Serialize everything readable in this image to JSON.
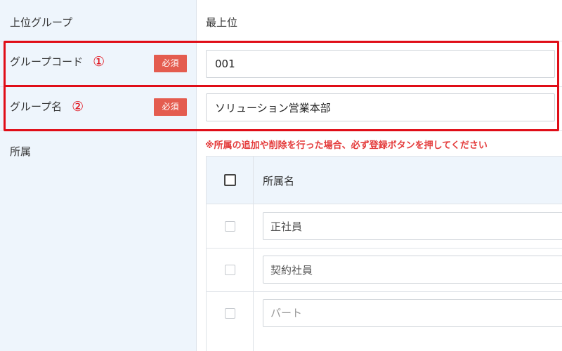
{
  "form": {
    "parent_group": {
      "label": "上位グループ",
      "value": "最上位"
    },
    "group_code": {
      "label": "グループコード",
      "marker": "①",
      "required_badge": "必須",
      "value": "001"
    },
    "group_name": {
      "label": "グループ名",
      "marker": "②",
      "required_badge": "必須",
      "value": "ソリューション営業本部"
    },
    "affiliation": {
      "label": "所属",
      "warning": "※所属の追加や削除を行った場合、必ず登録ボタンを押してください",
      "table": {
        "header": "所属名",
        "rows": [
          {
            "value": "正社員",
            "checked": false
          },
          {
            "value": "契約社員",
            "checked": false
          },
          {
            "value": "",
            "placeholder": "パート",
            "checked": false
          }
        ]
      }
    }
  },
  "colors": {
    "label_background": "#eef5fc",
    "highlight_border": "#e00d17",
    "required_badge": "#e45c4f",
    "warning_text": "#e43b3b"
  }
}
